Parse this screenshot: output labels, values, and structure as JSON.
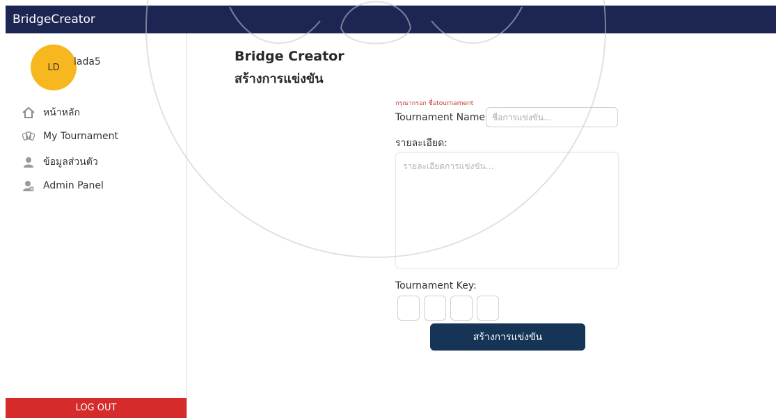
{
  "app": {
    "brand": "BridgeCreator"
  },
  "user": {
    "initials": "LD",
    "name": "lada5"
  },
  "sidebar": {
    "items": [
      {
        "label": "หน้าหลัก",
        "icon": "home-icon"
      },
      {
        "label": "My Tournament",
        "icon": "cards-icon"
      },
      {
        "label": "ข้อมูลส่วนตัว",
        "icon": "user-icon"
      },
      {
        "label": "Admin Panel",
        "icon": "admin-icon"
      }
    ],
    "logout_label": "LOG OUT"
  },
  "main": {
    "title": "Bridge Creator",
    "subtitle": "สร้างการแข่งขัน",
    "error_text": "กรุณากรอก ชื่อtournament",
    "name_label": "Tournament Name:",
    "name_placeholder": "ชื่อการแข่งขัน...",
    "name_value": "",
    "desc_label": "รายละเอียด:",
    "desc_placeholder": "รายละเอียดการแข่งขัน...",
    "desc_value": "",
    "key_label": "Tournament Key:",
    "key_values": [
      "",
      "",
      "",
      ""
    ],
    "create_label": "สร้างการแข่งขัน"
  },
  "colors": {
    "topbar": "#1d2553",
    "avatar": "#f7b81f",
    "logout": "#d62b2b",
    "button": "#163456",
    "error": "#c0392b"
  }
}
